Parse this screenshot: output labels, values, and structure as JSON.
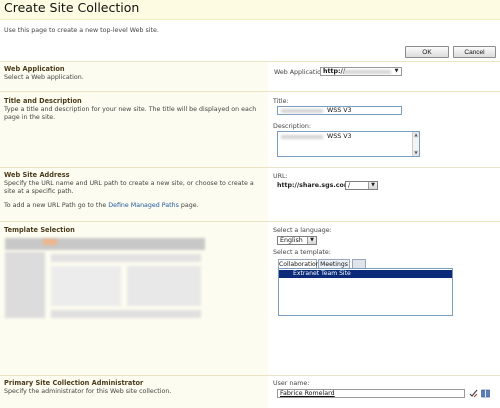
{
  "page": {
    "title": "Create Site Collection",
    "intro": "Use this page to create a new top-level Web site."
  },
  "actions": {
    "ok_label": "OK",
    "cancel_label": "Cancel"
  },
  "web_application": {
    "title": "Web Application",
    "description": "Select a Web application.",
    "field_label": "Web Application:",
    "value": "http://"
  },
  "title_description": {
    "title": "Title and Description",
    "description": "Type a title and description for your new site. The title will be displayed on each page in the site.",
    "title_label": "Title:",
    "title_value": "WSS V3",
    "description_label": "Description:",
    "description_value": "WSS V3"
  },
  "web_site_address": {
    "title": "Web Site Address",
    "description": "Specify the URL name and URL path to create a new site, or choose to create a site at a specific path.",
    "managed_paths_prefix": "To add a new URL Path go to the",
    "managed_paths_link": "Define Managed Paths",
    "managed_paths_suffix": "page.",
    "url_label": "URL:",
    "url_host": "http://share.sgs.com",
    "url_path": "/"
  },
  "template_selection": {
    "title": "Template Selection",
    "language_label": "Select a language:",
    "language_value": "English",
    "template_label": "Select a template:",
    "tabs": [
      "Collaboration",
      "Meetings"
    ],
    "selected_template": "Extranet Team Site"
  },
  "primary_admin": {
    "title": "Primary Site Collection Administrator",
    "description": "Specify the administrator for this Web site collection.",
    "user_label": "User name:",
    "user_value": "Fabrice Romelard"
  },
  "colors": {
    "header_bg": "#fdfbe2",
    "section_title": "#4b3b1c",
    "link": "#1d5a9e",
    "selection": "#0b2b7a"
  }
}
